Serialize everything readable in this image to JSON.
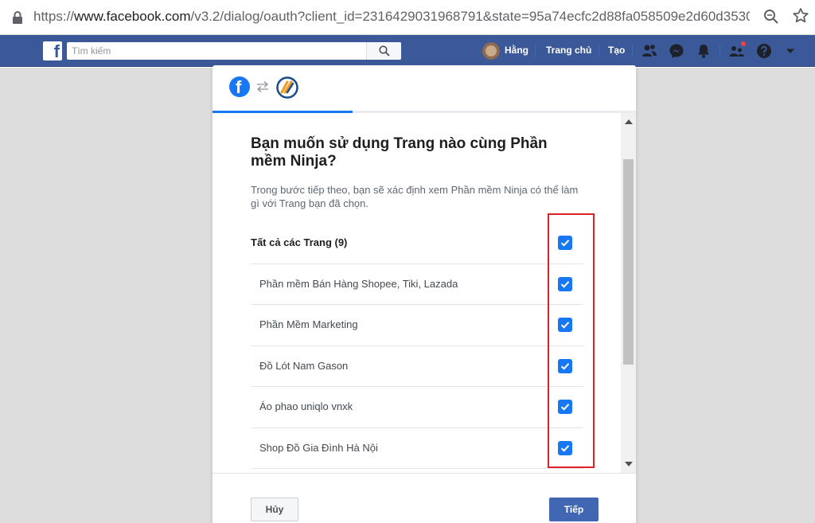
{
  "browser": {
    "url_scheme": "https://",
    "url_host": "www.facebook.com",
    "url_path": "/v3.2/dialog/oauth?client_id=2316429031968791&state=95a74ecfc2d88fa058509e2d60d3530…"
  },
  "fb_nav": {
    "search_placeholder": "Tìm kiếm",
    "user_name": "Hằng",
    "home_label": "Trang chủ",
    "create_label": "Tạo",
    "brand_color": "#3b5998"
  },
  "dialog": {
    "progress_fraction": 0.33,
    "title": "Bạn muốn sử dụng Trang nào cùng Phần mềm Ninja?",
    "description": "Trong bước tiếp theo, bạn sẽ xác định xem Phần mềm Ninja có thể làm gì với Trang bạn đã chọn.",
    "all_pages": {
      "label": "Tất cả các Trang (9)",
      "checked": true
    },
    "pages": [
      {
        "label": "Phần mềm Bán Hàng Shopee, Tiki, Lazada",
        "checked": true
      },
      {
        "label": "Phần Mềm Marketing",
        "checked": true
      },
      {
        "label": "Đồ Lót Nam Gason",
        "checked": true
      },
      {
        "label": "Áo phao uniqlo vnxk",
        "checked": true
      },
      {
        "label": "Shop Đồ Gia Đình Hà Nội",
        "checked": true
      }
    ],
    "cancel_label": "Hủy",
    "next_label": "Tiếp",
    "accent_color": "#1877f2",
    "highlight_color": "#e0202a"
  }
}
